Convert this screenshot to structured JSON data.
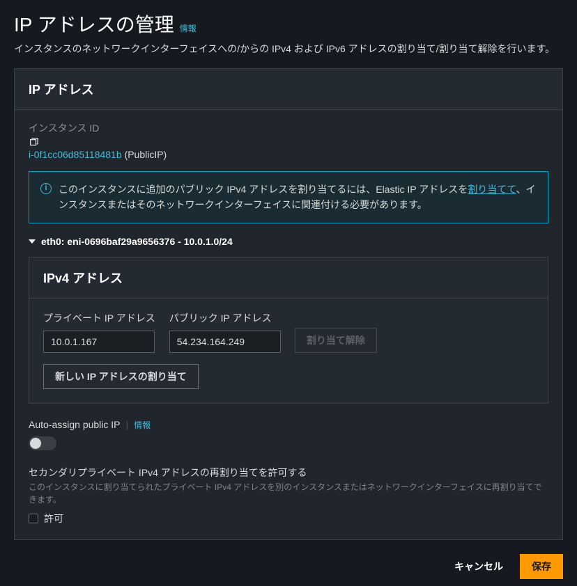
{
  "header": {
    "title": "IP アドレスの管理",
    "info_link": "情報",
    "description": "インスタンスのネットワークインターフェイスへの/からの IPv4 および IPv6 アドレスの割り当て/割り当て解除を行います。"
  },
  "panel": {
    "title": "IP アドレス",
    "instance_id_label": "インスタンス ID",
    "instance_id": "i-0f1cc06d85118481b",
    "instance_name_suffix": " (PublicIP)",
    "banner": {
      "text_before": "このインスタンスに追加のパブリック IPv4 アドレスを割り当てるには、Elastic IP アドレスを",
      "link": "割り当てて",
      "text_after": "、インスタンスまたはそのネットワークインターフェイスに関連付ける必要があります。"
    },
    "eni_label": "eth0: eni-0696baf29a9656376 - 10.0.1.0/24",
    "ipv4": {
      "section_title": "IPv4 アドレス",
      "private_label": "プライベート IP アドレス",
      "public_label": "パブリック IP アドレス",
      "private_value": "10.0.1.167",
      "public_value": "54.234.164.249",
      "unassign_button": "割り当て解除",
      "assign_new_button": "新しい IP アドレスの割り当て"
    },
    "auto_assign": {
      "label": "Auto-assign public IP",
      "info_link": "情報"
    },
    "secondary": {
      "title": "セカンダリプライベート IPv4 アドレスの再割り当てを許可する",
      "helper": "このインスタンスに割り当てられたプライベート IPv4 アドレスを別のインスタンスまたはネットワークインターフェイスに再割り当てできます。",
      "checkbox_label": "許可"
    }
  },
  "footer": {
    "cancel": "キャンセル",
    "save": "保存"
  }
}
